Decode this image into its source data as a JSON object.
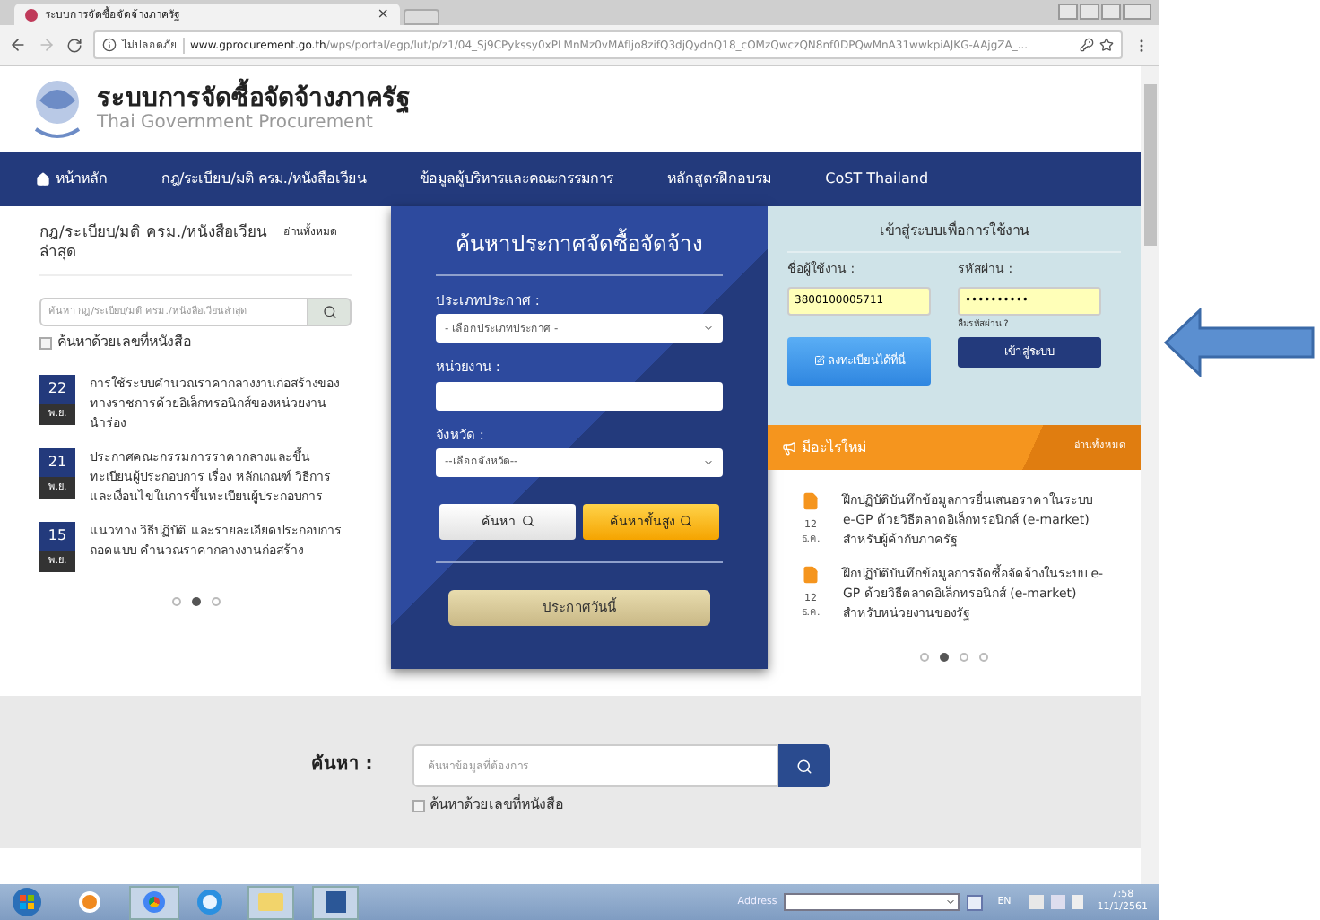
{
  "browser": {
    "tab_title": "ระบบการจัดซื้อจัดจ้างภาครัฐ",
    "tab_close": "×",
    "security_label": "ไม่ปลอดภัย",
    "url_host": "www.gprocurement.go.th",
    "url_path": "/wps/portal/egp/lut/p/z1/04_Sj9CPykssy0xPLMnMz0vMAfIjo8zifQ3djQydnQ18_cOMzQwczQN8nf0DPQwMnA31wwkpiAJKG-AAjgZA_..."
  },
  "site": {
    "title": "ระบบการจัดซื้อจัดจ้างภาครัฐ",
    "subtitle": "Thai Government Procurement"
  },
  "nav": [
    {
      "label": "หน้าหลัก",
      "kind": "home"
    },
    {
      "label": "กฎ/ระเบียบ/มติ ครม./หนังสือเวียน",
      "kind": "text"
    },
    {
      "label": "ข้อมูลผู้บริหารและคณะกรรมการ",
      "kind": "text"
    },
    {
      "label": "หลักสูตรฝึกอบรม",
      "kind": "text"
    },
    {
      "label": "CoST Thailand",
      "kind": "text"
    }
  ],
  "regulations": {
    "title": "กฎ/ระเบียบ/มติ ครม./หนังสือเวียนล่าสุด",
    "read_all": "อ่านทั้งหมด",
    "search_placeholder": "ค้นหา กฎ/ระเบียบ/มติ ครม./หนังสือเวียนล่าสุด",
    "checkbox": {
      "label": "ค้นหาด้วยเลขที่หนังสือ",
      "checked": false
    },
    "items": [
      {
        "day": "22",
        "month": "พ.ย.",
        "text": "การใช้ระบบคำนวณราคากลางงานก่อสร้างของทางราชการด้วยอิเล็กทรอนิกส์ของหน่วยงานนำร่อง"
      },
      {
        "day": "21",
        "month": "พ.ย.",
        "text": "ประกาศคณะกรรมการราคากลางและขึ้นทะเบียนผู้ประกอบการ เรื่อง หลักเกณฑ์ วิธีการ และเงื่อนไขในการขึ้นทะเบียนผู้ประกอบการ"
      },
      {
        "day": "15",
        "month": "พ.ย.",
        "text": "แนวทาง วิธีปฏิบัติ และรายละเอียดประกอบการถอดแบบ คำนวณราคากลางงานก่อสร้าง"
      }
    ],
    "pager": [
      {
        "selected": false
      },
      {
        "selected": true
      },
      {
        "selected": false
      }
    ]
  },
  "announcement_search": {
    "title": "ค้นหาประกาศจัดซื้อจัดจ้าง",
    "type_label": "ประเภทประกาศ :",
    "type_value": "- เลือกประเภทประกาศ -",
    "agency_label": "หน่วยงาน :",
    "province_label": "จังหวัด :",
    "province_value": "--เลือกจังหวัด--",
    "search_button": "ค้นหา",
    "advanced_button": "ค้นหาขั้นสูง",
    "today_button": "ประกาศวันนี้"
  },
  "login": {
    "title": "เข้าสู่ระบบเพื่อการใช้งาน",
    "username_label": "ชื่อผู้ใช้งาน :",
    "username": "3800100005711",
    "password_label": "รหัสผ่าน :",
    "password": "••••••••••",
    "forgot": "ลืมรหัสผ่าน ?",
    "register_button": "ลงทะเบียนได้ที่นี่",
    "login_button": "เข้าสู่ระบบ"
  },
  "news": {
    "title": "มีอะไรใหม่",
    "read_all": "อ่านทั้งหมด",
    "items": [
      {
        "day": "12",
        "month": "ธ.ค.",
        "text": "ฝึกปฏิบัติบันทึกข้อมูลการยื่นเสนอราคาในระบบ e-GP ด้วยวิธีตลาดอิเล็กทรอนิกส์ (e-market) สำหรับผู้ค้ากับภาครัฐ"
      },
      {
        "day": "12",
        "month": "ธ.ค.",
        "text": "ฝึกปฏิบัติบันทึกข้อมูลการจัดซื้อจัดจ้างในระบบ e-GP ด้วยวิธีตลาดอิเล็กทรอนิกส์ (e-market) สำหรับหน่วยงานของรัฐ"
      }
    ],
    "pager": [
      {
        "selected": false
      },
      {
        "selected": true
      },
      {
        "selected": false
      },
      {
        "selected": false
      }
    ]
  },
  "bottom_search": {
    "label": "ค้นหา :",
    "placeholder": "ค้นหาข้อมูลที่ต้องการ",
    "checkbox": {
      "label": "ค้นหาด้วยเลขที่หนังสือ",
      "checked": false
    }
  },
  "taskbar": {
    "address_label": "Address",
    "language": "EN",
    "time": "7:58",
    "date": "11/1/2561"
  }
}
